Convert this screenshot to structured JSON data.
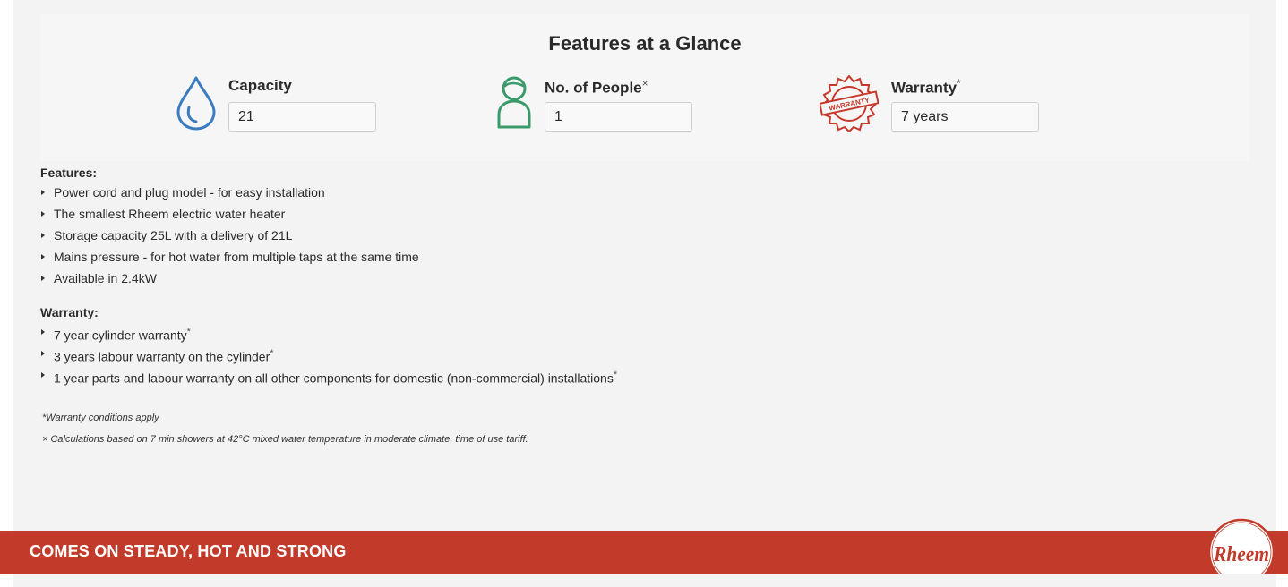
{
  "glance": {
    "title": "Features at a Glance",
    "capacity": {
      "label": "Capacity",
      "value": "21",
      "icon": "water-drop-icon"
    },
    "people": {
      "label": "No. of People",
      "marker": "×",
      "value": "1",
      "icon": "person-icon"
    },
    "warranty": {
      "label": "Warranty",
      "marker": "*",
      "value": "7 years",
      "icon": "warranty-seal-icon",
      "seal_text": "WARRANTY"
    }
  },
  "features": {
    "title": "Features:",
    "items": [
      "Power cord and plug model - for easy installation",
      "The smallest Rheem electric water heater",
      "Storage capacity 25L with a delivery of 21L",
      "Mains pressure - for hot water from multiple taps at the same time",
      "Available in 2.4kW"
    ]
  },
  "warranty_details": {
    "title": "Warranty:",
    "items": [
      {
        "text": "7 year cylinder warranty",
        "marker": "*"
      },
      {
        "text": "3 years labour warranty on the cylinder",
        "marker": "*"
      },
      {
        "text": "1 year parts and labour warranty on all other components for domestic (non-commercial) installations",
        "marker": "*"
      }
    ]
  },
  "footnotes": {
    "warranty_note": "*Warranty conditions apply",
    "calc_note": "× Calculations based on 7 min showers at 42°C mixed water temperature in moderate climate, time of use tariff."
  },
  "banner": {
    "text": "COMES ON STEADY, HOT AND STRONG",
    "logo_text": "Rheem"
  },
  "colors": {
    "brand_red": "#c23b2a",
    "drop_blue": "#3b7bbf",
    "person_green": "#3a9a6a",
    "seal_red": "#c8372b"
  }
}
